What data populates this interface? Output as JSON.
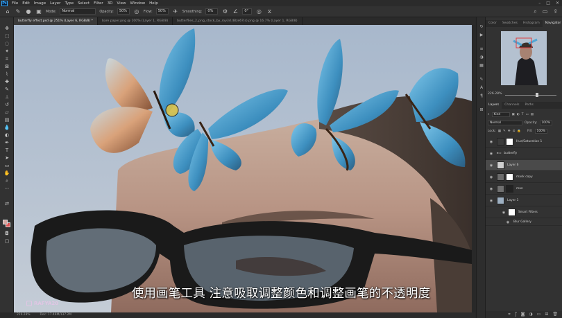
{
  "menu": [
    "File",
    "Edit",
    "Image",
    "Layer",
    "Type",
    "Select",
    "Filter",
    "3D",
    "View",
    "Window",
    "Help"
  ],
  "window_controls": [
    "–",
    "□",
    "✕"
  ],
  "options": {
    "mode_label": "Mode:",
    "mode_value": "Normal",
    "opacity_label": "Opacity:",
    "opacity_value": "50%",
    "flow_label": "Flow:",
    "flow_value": "50%",
    "smoothing_label": "Smoothing:",
    "smoothing_value": "0%",
    "angle_value": "0°"
  },
  "tabs": [
    "butterfly effect.psd @ 251% (Layer 6, RGB/8) *",
    "bare paper.png @ 100% (Layer 1, RGB/8)",
    "butterflies_2_png_stock_by_roy3d.d8ze6?(s).png @ 16.7% (Layer 1, RGB/8)"
  ],
  "status": {
    "zoom": "226.28%",
    "doc": "Doc: 17.46M/137.2M"
  },
  "subtitle": "使用画笔工具 注意吸取调整颜色和调整画笔的不透明度",
  "watermark": "RAFYA20",
  "panels": {
    "top_tabs": [
      "Color",
      "Swatches",
      "Histogram",
      "Navigator"
    ],
    "nav_zoom": "226.28%",
    "layer_tabs": [
      "Layers",
      "Channels",
      "Paths"
    ],
    "kind_label": "Kind",
    "blend_mode": "Normal",
    "opacity_label": "Opacity:",
    "opacity_value": "100%",
    "lock_label": "Lock:",
    "fill_label": "Fill:",
    "fill_value": "100%",
    "layers": [
      {
        "name": "Hue/Saturation 1"
      },
      {
        "name": "butterfly"
      },
      {
        "name": "Layer 6"
      },
      {
        "name": "mask copy"
      },
      {
        "name": "man"
      },
      {
        "name": "Layer 1"
      },
      {
        "name": "Smart Filters"
      },
      {
        "name": "Blur Gallery"
      }
    ]
  },
  "colors": {
    "accent": "#31a8ff",
    "canvas_sky": "#a9b6c8",
    "butterfly_blue": "#4ea6d6",
    "foreground_swatch": "#d6a6a0",
    "background_swatch": "#e05050"
  }
}
